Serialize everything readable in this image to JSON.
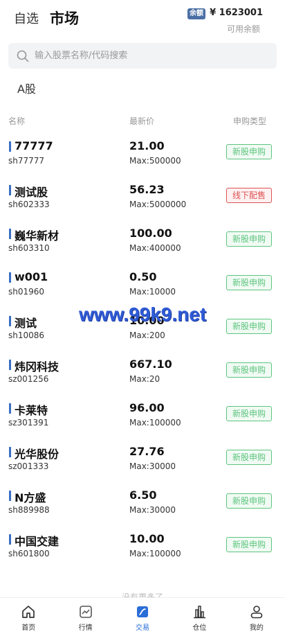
{
  "header": {
    "tab_watchlist": "自选",
    "tab_market": "市场",
    "balance_badge": "余额",
    "balance_value": "¥ 1623001",
    "balance_label": "可用余额"
  },
  "search": {
    "placeholder": "输入股票名称/代码搜索"
  },
  "market_tab": "A股",
  "columns": {
    "name": "名称",
    "price": "最新价",
    "type": "申购类型"
  },
  "stocks": [
    {
      "name": "77777",
      "code": "sh77777",
      "price": "21.00",
      "max": "Max:500000",
      "type": "新股申购",
      "type_color": "green"
    },
    {
      "name": "测试股",
      "code": "sh602333",
      "price": "56.23",
      "max": "Max:5000000",
      "type": "线下配售",
      "type_color": "red"
    },
    {
      "name": "巍华新材",
      "code": "sh603310",
      "price": "100.00",
      "max": "Max:400000",
      "type": "新股申购",
      "type_color": "green"
    },
    {
      "name": "w001",
      "code": "sh01960",
      "price": "0.50",
      "max": "Max:10000",
      "type": "新股申购",
      "type_color": "green"
    },
    {
      "name": "测试",
      "code": "sh10086",
      "price": "10.00",
      "max": "Max:200",
      "type": "新股申购",
      "type_color": "green"
    },
    {
      "name": "炜冈科技",
      "code": "sz001256",
      "price": "667.10",
      "max": "Max:20",
      "type": "新股申购",
      "type_color": "green"
    },
    {
      "name": "卡莱特",
      "code": "sz301391",
      "price": "96.00",
      "max": "Max:100000",
      "type": "新股申购",
      "type_color": "green"
    },
    {
      "name": "光华股份",
      "code": "sz001333",
      "price": "27.76",
      "max": "Max:30000",
      "type": "新股申购",
      "type_color": "green"
    },
    {
      "name": "N方盛",
      "code": "sh889988",
      "price": "6.50",
      "max": "Max:30000",
      "type": "新股申购",
      "type_color": "green"
    },
    {
      "name": "中国交建",
      "code": "sh601800",
      "price": "10.00",
      "max": "Max:100000",
      "type": "新股申购",
      "type_color": "green"
    }
  ],
  "no_more": "没有更多了",
  "watermark": "www.99k9.net",
  "tabbar": [
    {
      "label": "首页",
      "icon": "home-icon",
      "active": false
    },
    {
      "label": "行情",
      "icon": "chart-icon",
      "active": false
    },
    {
      "label": "交易",
      "icon": "trade-icon",
      "active": true
    },
    {
      "label": "仓位",
      "icon": "bar-chart-icon",
      "active": false
    },
    {
      "label": "我的",
      "icon": "user-icon",
      "active": false
    }
  ],
  "colors": {
    "accent": "#2a6ed8",
    "green_tag": "#5dc47e",
    "red_tag": "#e05252",
    "stock_bar": "#3b6fc4"
  }
}
